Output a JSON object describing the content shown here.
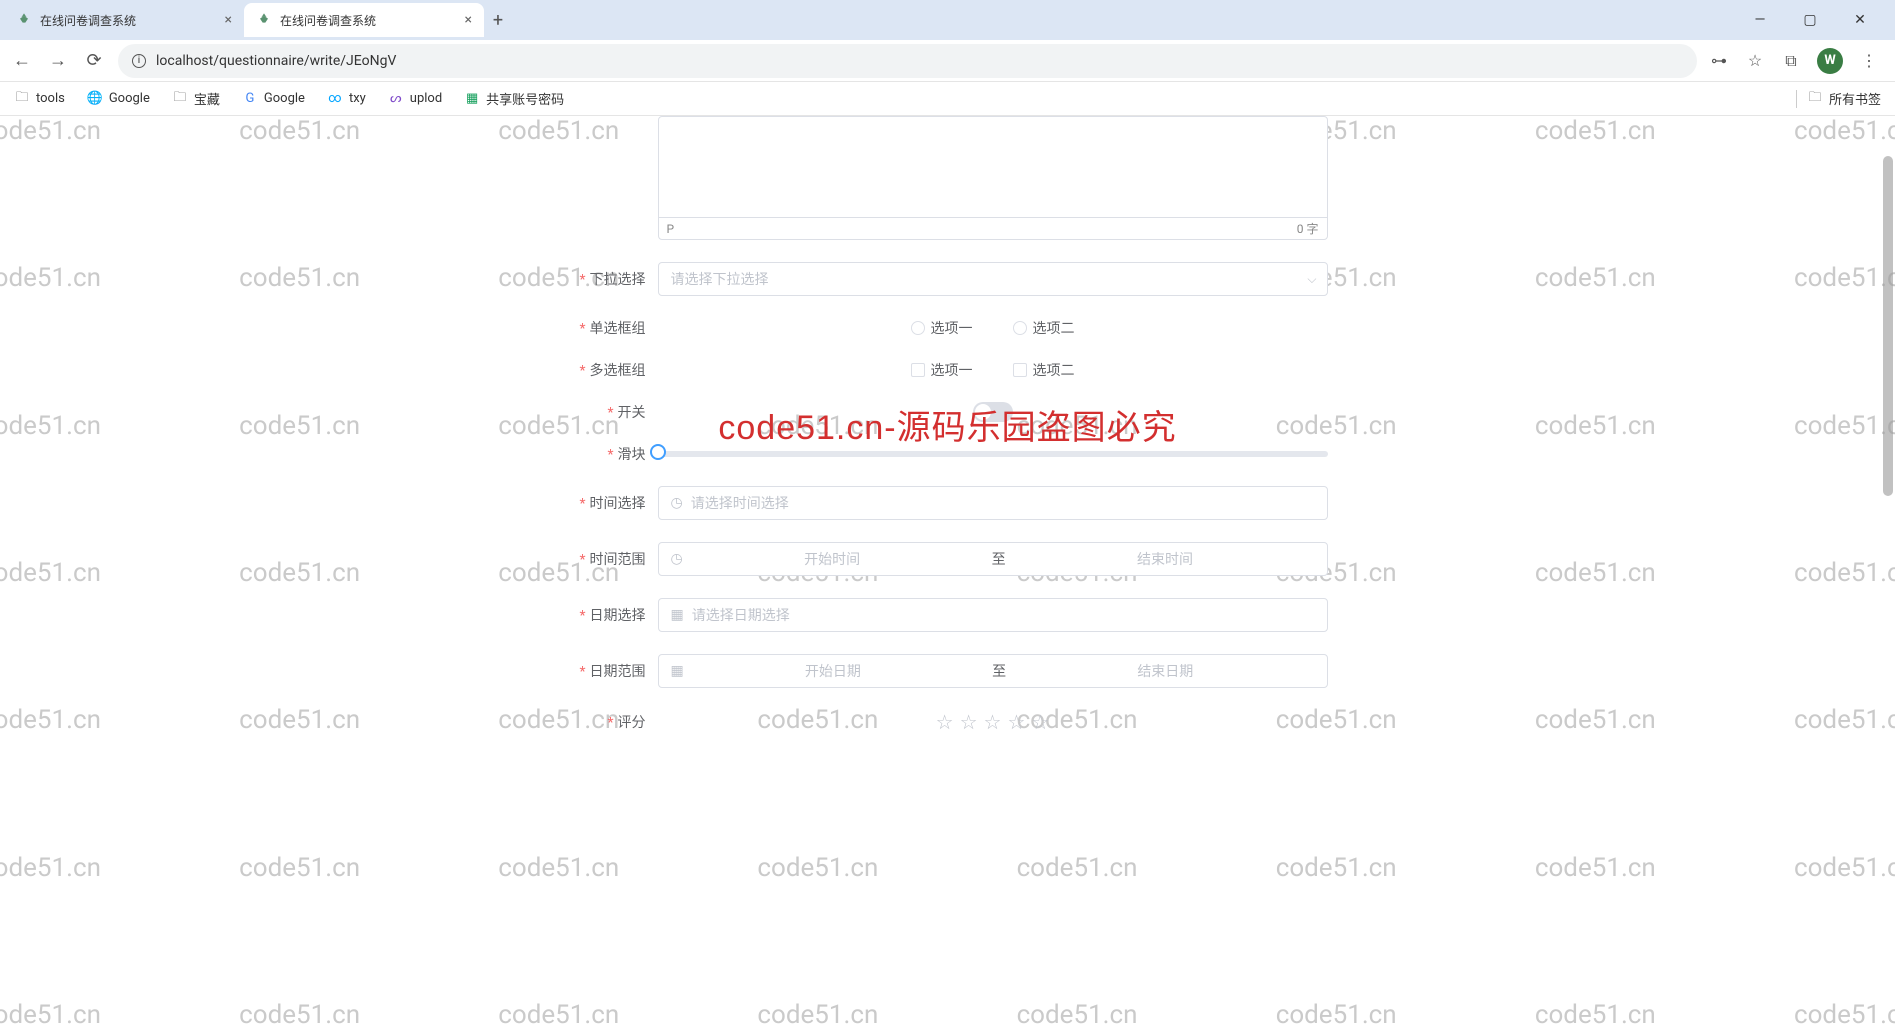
{
  "browser": {
    "tabs": [
      {
        "title": "在线问卷调查系统",
        "active": false
      },
      {
        "title": "在线问卷调查系统",
        "active": true
      }
    ],
    "url": "localhost/questionnaire/write/JEoNgV",
    "avatar": "W",
    "bookmarks": [
      {
        "label": "tools",
        "type": "folder"
      },
      {
        "label": "Google",
        "type": "google"
      },
      {
        "label": "宝藏",
        "type": "folder"
      },
      {
        "label": "Google",
        "type": "google-g"
      },
      {
        "label": "txy",
        "type": "txy"
      },
      {
        "label": "uplod",
        "type": "uplod"
      },
      {
        "label": "共享账号密码",
        "type": "sheet"
      }
    ],
    "all_bookmarks": "所有书签"
  },
  "watermark": "code51.cn",
  "overlay": "code51.cn-源码乐园盗图必究",
  "editor": {
    "path": "P",
    "char_count": "0 字"
  },
  "form": {
    "dropdown": {
      "label": "下拉选择",
      "placeholder": "请选择下拉选择"
    },
    "radio": {
      "label": "单选框组",
      "options": [
        "选项一",
        "选项二"
      ]
    },
    "checkbox": {
      "label": "多选框组",
      "options": [
        "选项一",
        "选项二"
      ]
    },
    "switch": {
      "label": "开关"
    },
    "slider": {
      "label": "滑块"
    },
    "time_pick": {
      "label": "时间选择",
      "placeholder": "请选择时间选择"
    },
    "time_range": {
      "label": "时间范围",
      "start": "开始时间",
      "sep": "至",
      "end": "结束时间"
    },
    "date_pick": {
      "label": "日期选择",
      "placeholder": "请选择日期选择"
    },
    "date_range": {
      "label": "日期范围",
      "start": "开始日期",
      "sep": "至",
      "end": "结束日期"
    },
    "rate": {
      "label": "评分"
    }
  }
}
